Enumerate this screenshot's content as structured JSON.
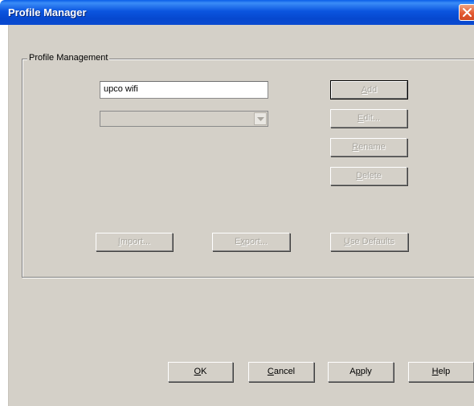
{
  "window": {
    "title": "Profile Manager"
  },
  "group": {
    "label": "Profile Management"
  },
  "profile_name": {
    "value": "upco wifi"
  },
  "profile_select": {
    "value": ""
  },
  "buttons": {
    "add": {
      "key": "A",
      "rest": "dd",
      "enabled": false
    },
    "edit": {
      "key": "E",
      "rest": "dit...",
      "enabled": false
    },
    "rename": {
      "key": "R",
      "rest": "ename",
      "enabled": false
    },
    "delete": {
      "key": "D",
      "rest": "elete",
      "enabled": false
    },
    "import": {
      "key": "I",
      "rest": "mport...",
      "enabled": false
    },
    "export": {
      "pre": "E",
      "key": "x",
      "rest": "port...",
      "enabled": false
    },
    "use_defaults": {
      "key": "U",
      "rest": "se Defaults",
      "enabled": false
    },
    "ok": {
      "key": "O",
      "rest": "K"
    },
    "cancel": {
      "key": "C",
      "rest": "ancel"
    },
    "apply": {
      "pre": "A",
      "key": "p",
      "rest": "ply"
    },
    "help": {
      "key": "H",
      "rest": "elp"
    }
  },
  "icons": {
    "close": "close-icon",
    "dropdown": "chevron-down-icon"
  }
}
